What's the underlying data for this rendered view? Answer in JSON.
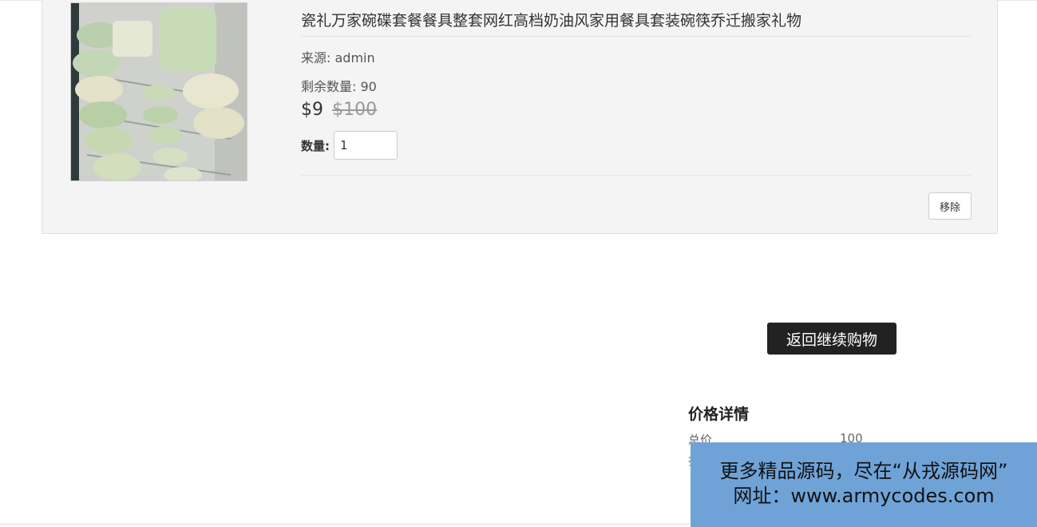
{
  "cart_item": {
    "title": "瓷礼万家碗碟套餐餐具整套网红高档奶油风家用餐具套装碗筷乔迁搬家礼物",
    "source": "来源: admin",
    "stock": "剩余数量: 90",
    "price_current": "$9",
    "price_original": "$100",
    "qty_label": "数量:",
    "qty_value": "1",
    "remove_label": "移除"
  },
  "continue_label": "返回继续购物",
  "price_details": {
    "title": "价格详情",
    "total_label": "总价",
    "total_value": "100"
  },
  "watermark": {
    "line1": "更多精品源码，尽在“从戎源码网”",
    "line2": "网址：www.armycodes.com"
  },
  "colors": {
    "card_bg": "#f4f4f4",
    "primary_button": "#222222",
    "watermark_bg": "#6fa3d8"
  }
}
